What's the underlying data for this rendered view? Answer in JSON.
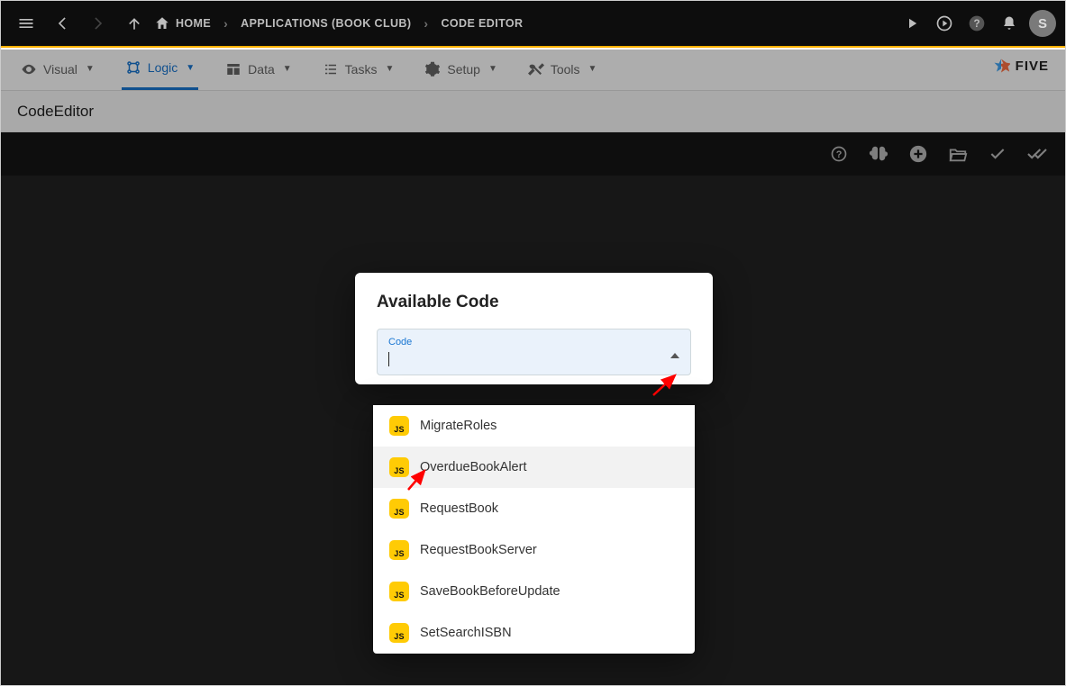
{
  "topbar": {
    "home_label": "HOME",
    "crumb2": "APPLICATIONS (BOOK CLUB)",
    "crumb3": "CODE EDITOR",
    "avatar_initial": "S"
  },
  "tabs": {
    "visual": "Visual",
    "logic": "Logic",
    "data": "Data",
    "tasks": "Tasks",
    "setup": "Setup",
    "tools": "Tools"
  },
  "brand": {
    "name": "FIVE"
  },
  "section": {
    "title": "CodeEditor"
  },
  "popup": {
    "title": "Available Code",
    "field_label": "Code",
    "field_value": ""
  },
  "dropdown": {
    "items": [
      {
        "badge": "JS",
        "label": "MigrateRoles",
        "hover": false
      },
      {
        "badge": "JS",
        "label": "OverdueBookAlert",
        "hover": true
      },
      {
        "badge": "JS",
        "label": "RequestBook",
        "hover": false
      },
      {
        "badge": "JS",
        "label": "RequestBookServer",
        "hover": false
      },
      {
        "badge": "JS",
        "label": "SaveBookBeforeUpdate",
        "hover": false
      },
      {
        "badge": "JS",
        "label": "SetSearchISBN",
        "hover": false
      }
    ]
  },
  "annotation_color": "#ff0000"
}
